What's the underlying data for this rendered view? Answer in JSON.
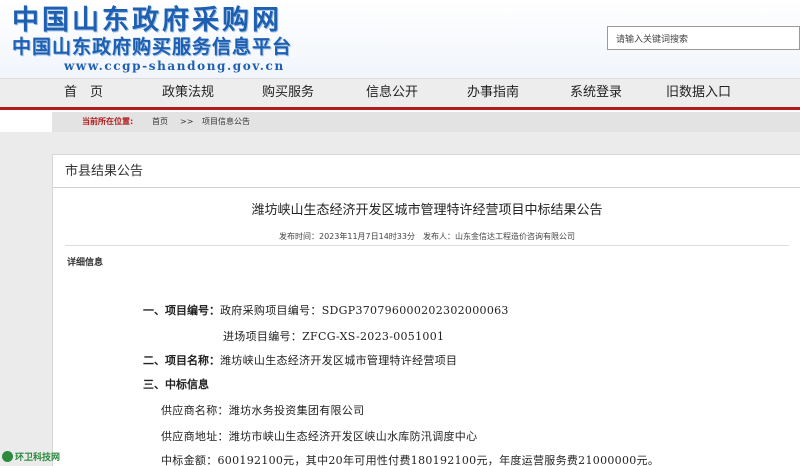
{
  "header": {
    "logo_line1": "中国山东政府采购网",
    "logo_line2": "中国山东政府购买服务信息平台",
    "logo_url": "www.ccgp-shandong.gov.cn",
    "search_placeholder": "请输入关键词搜索"
  },
  "nav": {
    "items": [
      {
        "label": "首　页"
      },
      {
        "label": "政策法规"
      },
      {
        "label": "购买服务"
      },
      {
        "label": "信息公开"
      },
      {
        "label": "办事指南"
      },
      {
        "label": "系统登录"
      },
      {
        "label": "旧数据入口"
      }
    ],
    "accent_color": "#b31b1b"
  },
  "breadcrumb": {
    "label": "当前所在位置:",
    "home": "首页",
    "separator": ">>",
    "current": "项目信息公告"
  },
  "section": {
    "title": "市县结果公告"
  },
  "notice": {
    "title": "潍坊峡山生态经济开发区城市管理特许经营项目中标结果公告",
    "meta": "发布时间：2023年11月7日14时33分　发布人：山东金信达工程造价咨询有限公司",
    "detail_label": "详细信息",
    "item1_label": "一、项目编号：",
    "item1_value": "政府采购项目编号：SDGP370796000202302000063",
    "item1_value2": "进场项目编号：ZFCG-XS-2023-0051001",
    "item2_label": "二、项目名称：",
    "item2_value": "潍坊峡山生态经济开发区城市管理特许经营项目",
    "item3_label": "三、中标信息",
    "supplier_name": "供应商名称：潍坊水务投资集团有限公司",
    "supplier_address": "供应商地址：潍坊市峡山生态经济开发区峡山水库防汛调度中心",
    "bid_amount": "中标金额：600192100元，其中20年可用性付费180192100元，年度运营服务费21000000元。"
  },
  "watermark": {
    "text": "环卫科技网"
  }
}
